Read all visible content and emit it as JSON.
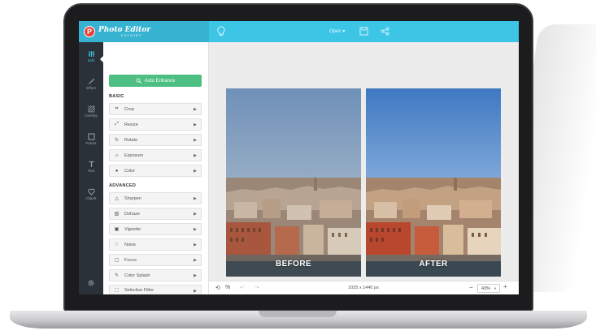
{
  "app": {
    "logo_letter": "P",
    "logo_title": "Photo Editor",
    "logo_subtitle": "FOTOJET"
  },
  "topbar": {
    "open_label": "Open ▾",
    "icons": [
      "bulb-icon",
      "save-icon",
      "share-icon"
    ]
  },
  "rail": {
    "items": [
      {
        "label": "Edit",
        "icon": "sliders-icon",
        "active": true
      },
      {
        "label": "Effect",
        "icon": "wand-icon",
        "active": false
      },
      {
        "label": "Overlay",
        "icon": "overlay-icon",
        "active": false
      },
      {
        "label": "Frame",
        "icon": "frame-icon",
        "active": false
      },
      {
        "label": "Text",
        "icon": "text-icon",
        "active": false
      },
      {
        "label": "Clipart",
        "icon": "heart-icon",
        "active": false
      }
    ],
    "bottom_icon": "gear-icon"
  },
  "panel": {
    "auto_enhance_label": "Auto Enhance",
    "basic_heading": "BASIC",
    "basic_tools": [
      {
        "label": "Crop",
        "icon": "crop-icon"
      },
      {
        "label": "Resize",
        "icon": "resize-icon"
      },
      {
        "label": "Rotate",
        "icon": "rotate-icon"
      },
      {
        "label": "Exposure",
        "icon": "sun-icon"
      },
      {
        "label": "Color",
        "icon": "drop-icon"
      }
    ],
    "advanced_heading": "ADVANCED",
    "advanced_tools": [
      {
        "label": "Sharpen",
        "icon": "triangle-icon"
      },
      {
        "label": "Dehaze",
        "icon": "dehaze-icon"
      },
      {
        "label": "Vignette",
        "icon": "vignette-icon"
      },
      {
        "label": "Noise",
        "icon": "noise-icon"
      },
      {
        "label": "Focus",
        "icon": "focus-icon"
      },
      {
        "label": "Color Splash",
        "icon": "brush-icon"
      },
      {
        "label": "Selective Filter",
        "icon": "selective-icon"
      }
    ]
  },
  "canvas": {
    "before_label": "BEFORE",
    "after_label": "AFTER"
  },
  "bottombar": {
    "dimensions": "1025 x 1440 px",
    "zoom_value": "43%",
    "zoom_minus": "−",
    "zoom_plus": "+"
  },
  "colors": {
    "topbar": "#3dc5e6",
    "rail": "#2b3138",
    "accent_green": "#4dbf82",
    "logo_red": "#e8423a"
  }
}
